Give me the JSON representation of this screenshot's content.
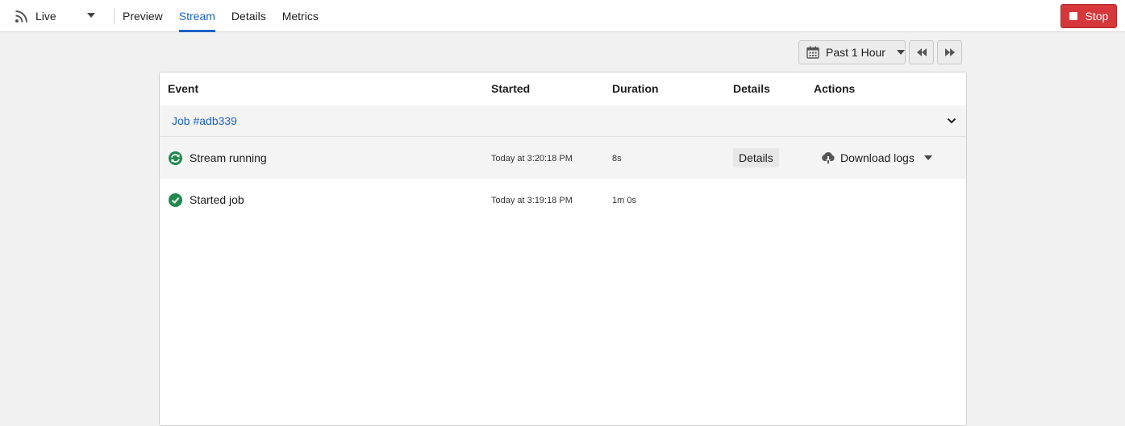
{
  "topbar": {
    "live_label": "Live",
    "tabs": [
      "Preview",
      "Stream",
      "Details",
      "Metrics"
    ],
    "active_tab": "Stream",
    "stop_label": "Stop"
  },
  "controls": {
    "range_label": "Past 1 Hour"
  },
  "table": {
    "headers": [
      "Event",
      "Started",
      "Duration",
      "Details",
      "Actions"
    ],
    "group_label": "Job #adb339",
    "rows": [
      {
        "event": "Stream running",
        "started": "Today at 3:20:18 PM",
        "duration": "8s",
        "details_label": "Details",
        "action_label": "Download logs",
        "status_icon": "sync-running-icon"
      },
      {
        "event": "Started job",
        "started": "Today at 3:19:18 PM",
        "duration": "1m 0s",
        "status_icon": "check-circle-icon"
      }
    ]
  },
  "colors": {
    "accent": "#1a62c4",
    "stop": "#d5373b",
    "success": "#1e8a4c"
  }
}
